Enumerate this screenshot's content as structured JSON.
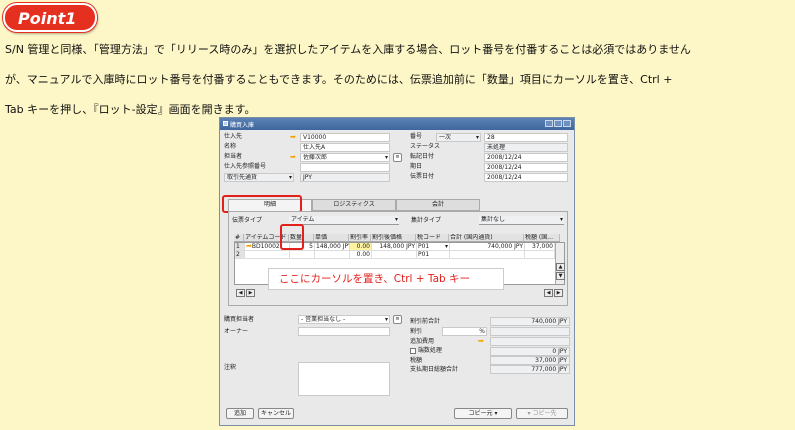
{
  "badge": "Point1",
  "paragraphs": [
    "S/N 管理と同様、「管理方法」で「リリース時のみ」を選択したアイテムを入庫する場合、ロット番号を付番することは必須ではありません",
    "が、マニュアルで入庫時にロット番号を付番することもできます。そのためには、伝票追加前に「数量」項目にカーソルを置き、Ctrl +",
    "Tab キーを押し、『ロット-設定』画面を開きます。"
  ],
  "window": {
    "title": "購買入庫",
    "header_left": [
      {
        "label": "仕入先",
        "value": "V10000",
        "arrow": true
      },
      {
        "label": "名称",
        "value": "仕入先A"
      },
      {
        "label": "担当者",
        "value": "佐藤次郎",
        "arrow": true,
        "dropdown": true
      },
      {
        "label": "仕入先参照番号",
        "value": ""
      },
      {
        "label": "取引先通貨",
        "value": "JPY",
        "dropdown": true
      }
    ],
    "header_right": [
      {
        "label": "番号",
        "prefix": "一次",
        "value": "28"
      },
      {
        "label": "ステータス",
        "value": "未処理"
      },
      {
        "label": "転記日付",
        "value": "2008/12/24"
      },
      {
        "label": "期日",
        "value": "2008/12/24"
      },
      {
        "label": "伝票日付",
        "value": "2008/12/24"
      }
    ],
    "tabs": [
      "明細",
      "ロジスティクス",
      "会計"
    ],
    "item_type_label": "伝票タイプ",
    "item_type_value": "アイテム",
    "summary_type_label": "集計タイプ",
    "summary_type_value": "集計なし",
    "grid": {
      "headers": [
        "#",
        "アイテムコード",
        "数量",
        "単価",
        "割引率",
        "割引後価格",
        "税コード",
        "合計 (国内通貨)",
        "税額 (国..."
      ],
      "rows": [
        [
          "1",
          "BD10002",
          "5",
          "148,000 JPY",
          "0.00",
          "148,000 JPY",
          "P01",
          "740,000 JPY",
          "37,000"
        ],
        [
          "2",
          "",
          "",
          "",
          "0.00",
          "",
          "P01",
          "",
          ""
        ]
      ]
    },
    "annotation": "ここにカーソルを置き、Ctrl + Tab キー",
    "footer_left": [
      {
        "label": "購買担当者",
        "value": "- 営業担当なし -"
      },
      {
        "label": "オーナー",
        "value": ""
      },
      {
        "label": "注釈",
        "value": ""
      }
    ],
    "totals": [
      {
        "label": "割引前合計",
        "value": "740,000 JPY"
      },
      {
        "label": "割引",
        "value": "%"
      },
      {
        "label": "追加費用",
        "value": ""
      },
      {
        "label": "端数処理",
        "value": "0 JPY"
      },
      {
        "label": "税額",
        "value": "37,000 JPY"
      },
      {
        "label": "支払期日総額合計",
        "value": "777,000 JPY"
      }
    ],
    "buttons": {
      "add": "追加",
      "cancel": "キャンセル",
      "copy_from": "コピー元",
      "copy_to": "コピー先"
    }
  }
}
